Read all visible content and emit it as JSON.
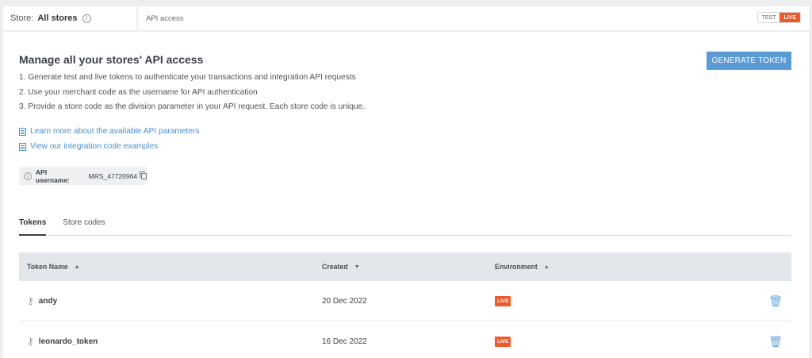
{
  "topbar": {
    "store_label": "Store:",
    "store_value": "All stores",
    "breadcrumb": "API access",
    "env_test": "TEST",
    "env_live": "LIVE"
  },
  "intro": {
    "heading": "Manage all your stores' API access",
    "steps": [
      "1. Generate test and live tokens to authenticate your transactions and integration API requests",
      "2. Use your merchant code as the username for API authentication",
      "3. Provide a store code as the division parameter in your API request. Each store code is unique."
    ],
    "generate_button": "GENERATE TOKEN"
  },
  "links": [
    "Learn more about the available API parameters",
    "View our integration code examples"
  ],
  "api_user": {
    "label": "API username:",
    "value": "MRS_47720964"
  },
  "tabs": [
    "Tokens",
    "Store codes"
  ],
  "table": {
    "headers": [
      "Token Name",
      "Created",
      "Environment"
    ],
    "rows": [
      {
        "name": "andy",
        "created": "20 Dec 2022",
        "env": "LIVE"
      },
      {
        "name": "leonardo_token",
        "created": "16 Dec 2022",
        "env": "LIVE"
      }
    ]
  },
  "colors": {
    "accent": "#5a9bd5",
    "live": "#ee5a2a"
  }
}
